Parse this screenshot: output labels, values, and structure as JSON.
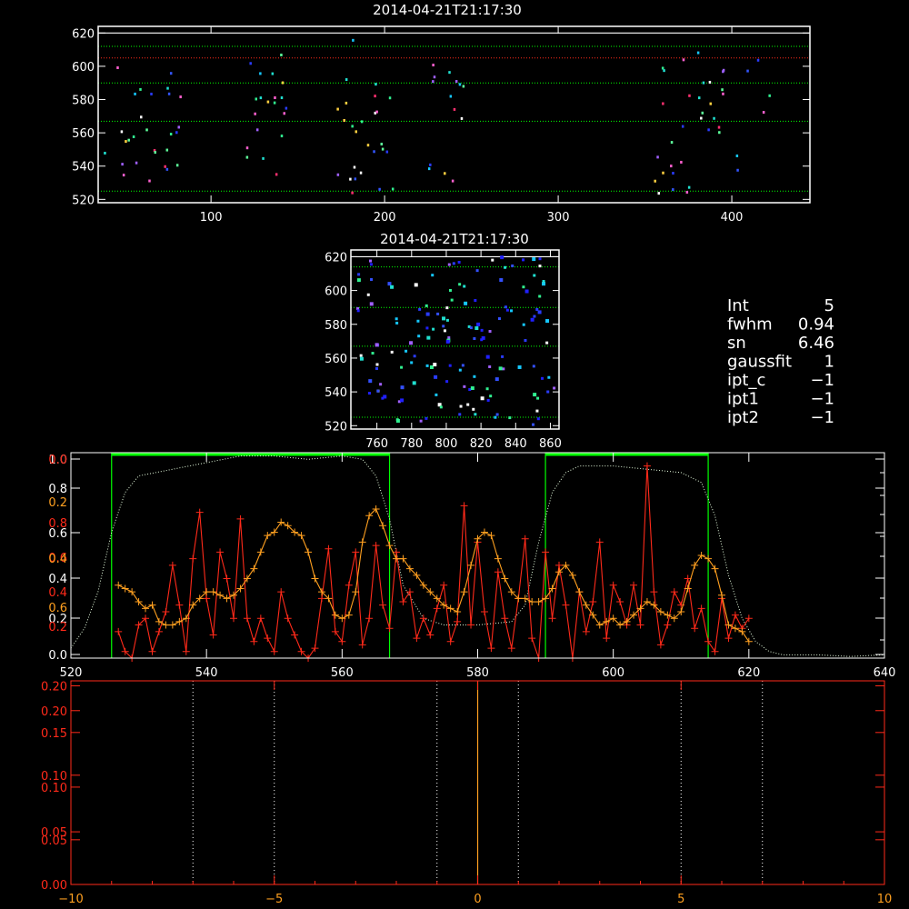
{
  "colors": {
    "background": "#000000",
    "axes": "#ffffff",
    "guide_line": "#00ff00",
    "red_axes": "#ff2a1a",
    "orange_curve": "#ffa020",
    "red_curve": "#ff2a1a"
  },
  "chart_data": [
    {
      "id": "top-panel",
      "type": "scatter",
      "title": "2014-04-21T21:17:30",
      "xlim": [
        35,
        445
      ],
      "ylim": [
        518,
        624
      ],
      "xticks": [
        100,
        200,
        300,
        400
      ],
      "yticks": [
        520,
        540,
        560,
        580,
        600,
        620
      ],
      "hlines_dotted_green": [
        525,
        567,
        590,
        612
      ],
      "hline_dotted_red": 605,
      "hline_white": 620,
      "point_clusters": [
        {
          "x": [
            38,
            82
          ],
          "y": [
            524,
            610
          ],
          "n": 28
        },
        {
          "x": [
            120,
            145
          ],
          "y": [
            525,
            608
          ],
          "n": 20
        },
        {
          "x": [
            168,
            205
          ],
          "y": [
            524,
            618
          ],
          "n": 26
        },
        {
          "x": [
            220,
            245
          ],
          "y": [
            530,
            605
          ],
          "n": 14
        },
        {
          "x": [
            355,
            395
          ],
          "y": [
            522,
            618
          ],
          "n": 32
        },
        {
          "x": [
            400,
            430
          ],
          "y": [
            522,
            612
          ],
          "n": 6
        }
      ]
    },
    {
      "id": "middle-panel",
      "type": "scatter",
      "title": "2014-04-21T21:17:30",
      "xlim": [
        745,
        865
      ],
      "ylim": [
        518,
        624
      ],
      "xticks": [
        760,
        780,
        800,
        820,
        840,
        860
      ],
      "yticks": [
        520,
        540,
        560,
        580,
        600,
        620
      ],
      "hlines_dotted_green": [
        525,
        567,
        590,
        614
      ],
      "hline_white": 620
    },
    {
      "id": "spectrum-panel",
      "type": "line",
      "xlim": [
        520,
        640
      ],
      "ylim": [
        0.0,
        0.62
      ],
      "xticks": [
        520,
        540,
        560,
        580,
        600,
        620,
        640
      ],
      "yticks_white": [
        "0.0",
        "0.2",
        "0.4",
        "0.6",
        "0.8",
        "1.0"
      ],
      "yticks_red": [
        "0.2",
        "0.4",
        "0.6",
        "0.8"
      ],
      "top_ticks": [
        "0.0",
        "0.2",
        "0.4",
        "0.6"
      ],
      "windows": [
        [
          526,
          567
        ],
        [
          590,
          614
        ]
      ],
      "dotted_profile": {
        "x": [
          520,
          522,
          524,
          526,
          528,
          530,
          535,
          540,
          545,
          550,
          555,
          560,
          563,
          565,
          567,
          569,
          572,
          575,
          580,
          585,
          587,
          589,
          591,
          593,
          595,
          600,
          605,
          610,
          613,
          615,
          617,
          619,
          621,
          623,
          625,
          630,
          635,
          640
        ],
        "y": [
          0.03,
          0.09,
          0.2,
          0.38,
          0.5,
          0.55,
          0.57,
          0.59,
          0.61,
          0.61,
          0.6,
          0.61,
          0.6,
          0.55,
          0.42,
          0.22,
          0.12,
          0.1,
          0.1,
          0.11,
          0.16,
          0.35,
          0.5,
          0.56,
          0.58,
          0.58,
          0.57,
          0.56,
          0.53,
          0.43,
          0.25,
          0.12,
          0.05,
          0.02,
          0.01,
          0.01,
          0.005,
          0.01
        ]
      },
      "orange_series": {
        "x": [
          527,
          528,
          529,
          530,
          531,
          532,
          533,
          534,
          535,
          536,
          537,
          538,
          539,
          540,
          541,
          542,
          543,
          544,
          545,
          546,
          547,
          548,
          549,
          550,
          551,
          552,
          553,
          554,
          555,
          556,
          557,
          558,
          559,
          560,
          561,
          562,
          563,
          564,
          565,
          566,
          567,
          568,
          569,
          570,
          571,
          572,
          573,
          574,
          575,
          576,
          577,
          578,
          579,
          580,
          581,
          582,
          583,
          584,
          585,
          586,
          587,
          588,
          589,
          590,
          591,
          592,
          593,
          594,
          595,
          596,
          597,
          598,
          599,
          600,
          601,
          602,
          603,
          604,
          605,
          606,
          607,
          608,
          609,
          610,
          611,
          612,
          613,
          614,
          615,
          616,
          617,
          618,
          619,
          620
        ],
        "y": [
          0.22,
          0.21,
          0.2,
          0.17,
          0.15,
          0.16,
          0.11,
          0.1,
          0.1,
          0.11,
          0.12,
          0.16,
          0.18,
          0.2,
          0.2,
          0.19,
          0.18,
          0.19,
          0.21,
          0.24,
          0.27,
          0.32,
          0.37,
          0.38,
          0.41,
          0.4,
          0.38,
          0.37,
          0.32,
          0.24,
          0.2,
          0.18,
          0.13,
          0.12,
          0.13,
          0.2,
          0.35,
          0.43,
          0.45,
          0.4,
          0.34,
          0.3,
          0.3,
          0.27,
          0.25,
          0.22,
          0.2,
          0.18,
          0.16,
          0.15,
          0.14,
          0.2,
          0.28,
          0.36,
          0.38,
          0.37,
          0.3,
          0.24,
          0.2,
          0.18,
          0.18,
          0.17,
          0.17,
          0.18,
          0.21,
          0.26,
          0.28,
          0.25,
          0.2,
          0.16,
          0.13,
          0.1,
          0.11,
          0.12,
          0.1,
          0.11,
          0.13,
          0.15,
          0.17,
          0.16,
          0.14,
          0.13,
          0.12,
          0.14,
          0.21,
          0.28,
          0.31,
          0.3,
          0.27,
          0.19,
          0.1,
          0.09,
          0.08,
          0.05
        ]
      },
      "red_series": {
        "x": [
          527,
          528,
          529,
          530,
          531,
          532,
          533,
          534,
          535,
          536,
          537,
          538,
          539,
          540,
          541,
          542,
          543,
          544,
          545,
          546,
          547,
          548,
          549,
          550,
          551,
          552,
          553,
          554,
          555,
          556,
          557,
          558,
          559,
          560,
          561,
          562,
          563,
          564,
          565,
          566,
          567,
          568,
          569,
          570,
          571,
          572,
          573,
          574,
          575,
          576,
          577,
          578,
          579,
          580,
          581,
          582,
          583,
          584,
          585,
          586,
          587,
          588,
          589,
          590,
          591,
          592,
          593,
          594,
          595,
          596,
          597,
          598,
          599,
          600,
          601,
          602,
          603,
          604,
          605,
          606,
          607,
          608,
          609,
          610,
          611,
          612,
          613,
          614,
          615,
          616,
          617,
          618,
          619,
          620
        ],
        "y": [
          0.08,
          0.02,
          0.0,
          0.1,
          0.12,
          0.02,
          0.08,
          0.14,
          0.28,
          0.16,
          0.02,
          0.3,
          0.44,
          0.18,
          0.07,
          0.32,
          0.24,
          0.12,
          0.42,
          0.12,
          0.05,
          0.12,
          0.06,
          0.02,
          0.2,
          0.12,
          0.07,
          0.02,
          0.0,
          0.03,
          0.18,
          0.33,
          0.08,
          0.05,
          0.22,
          0.32,
          0.04,
          0.12,
          0.34,
          0.16,
          0.09,
          0.32,
          0.17,
          0.2,
          0.06,
          0.12,
          0.07,
          0.15,
          0.22,
          0.05,
          0.11,
          0.46,
          0.1,
          0.35,
          0.14,
          0.03,
          0.26,
          0.12,
          0.03,
          0.18,
          0.36,
          0.06,
          0.0,
          0.32,
          0.12,
          0.28,
          0.16,
          0.0,
          0.2,
          0.08,
          0.17,
          0.35,
          0.06,
          0.22,
          0.17,
          0.1,
          0.22,
          0.1,
          0.58,
          0.2,
          0.04,
          0.1,
          0.2,
          0.16,
          0.24,
          0.09,
          0.15,
          0.05,
          0.02,
          0.18,
          0.06,
          0.13,
          0.09,
          0.12
        ]
      }
    },
    {
      "id": "bottom-panel",
      "type": "line",
      "xlim": [
        -10,
        10
      ],
      "ylim": [
        0.0,
        0.205
      ],
      "xticks": [
        "−10",
        "−5",
        "0",
        "5",
        "10"
      ],
      "xtick_values": [
        -10,
        -5,
        0,
        5,
        10
      ],
      "yticks_red": [
        "0.00",
        "0.05",
        "0.05",
        "0.10",
        "0.10",
        "0.15",
        "0.20",
        "0.20"
      ],
      "ytick_values": [
        0.0,
        0.045,
        0.053,
        0.098,
        0.11,
        0.153,
        0.175,
        0.2
      ],
      "vlines_dotted_white": [
        -7,
        -5,
        -1,
        1,
        5,
        7
      ],
      "vline_orange": 0
    }
  ],
  "info_panel": {
    "rows": [
      {
        "label": "Int",
        "value": "5"
      },
      {
        "label": "fwhm",
        "value": "0.94"
      },
      {
        "label": "sn",
        "value": "6.46"
      },
      {
        "label": "gaussfit",
        "value": "1"
      },
      {
        "label": "ipt_c",
        "value": "−1"
      },
      {
        "label": "ipt1",
        "value": "−1"
      },
      {
        "label": "ipt2",
        "value": "−1"
      }
    ]
  }
}
